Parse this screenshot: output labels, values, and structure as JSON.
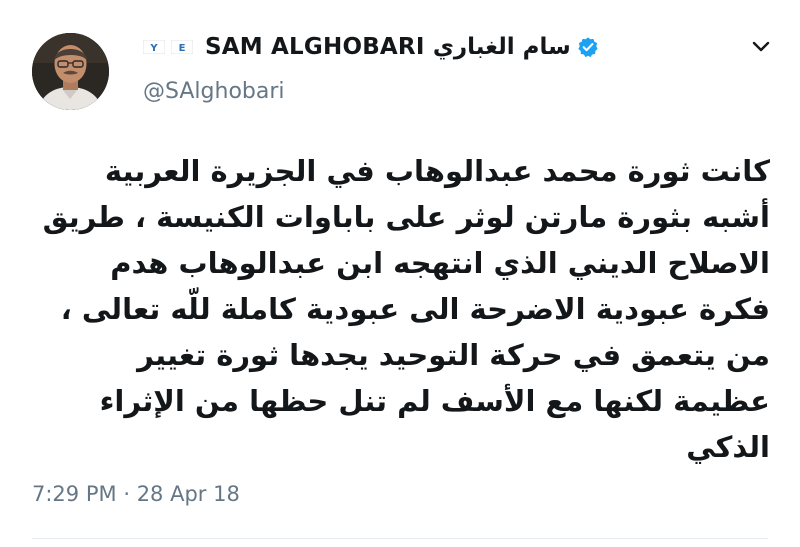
{
  "tweet": {
    "display_name": "SAM ALGHOBARI سام الغباري",
    "handle": "@SAlghobari",
    "text": "كانت ثورة محمد عبدالوهاب في الجزيرة العربية\nأشبه بثورة مارتن لوثر على باباوات الكنيسة ، طريق\nالاصلاح الديني الذي انتهجه ابن عبدالوهاب هدم\nفكرة عبودية الاضرحة الى عبودية كاملة للّه تعالى ،\nمن يتعمق في حركة التوحيد يجدها ثورة تغيير\nعظيمة لكنها مع الأسف لم تنل حظها من الإثراء\nالذكي",
    "time": "7:29 PM",
    "separator": "·",
    "date": "28 Apr 18"
  },
  "icons": {
    "flags": [
      "yemen-flag-icon",
      "egypt-flag-icon"
    ],
    "verified": "verified-badge-icon",
    "caret": "chevron-down-icon"
  },
  "colors": {
    "text_primary": "#14171a",
    "text_secondary": "#657786",
    "verified_blue": "#1da1f2",
    "divider": "#e6ecf0"
  }
}
